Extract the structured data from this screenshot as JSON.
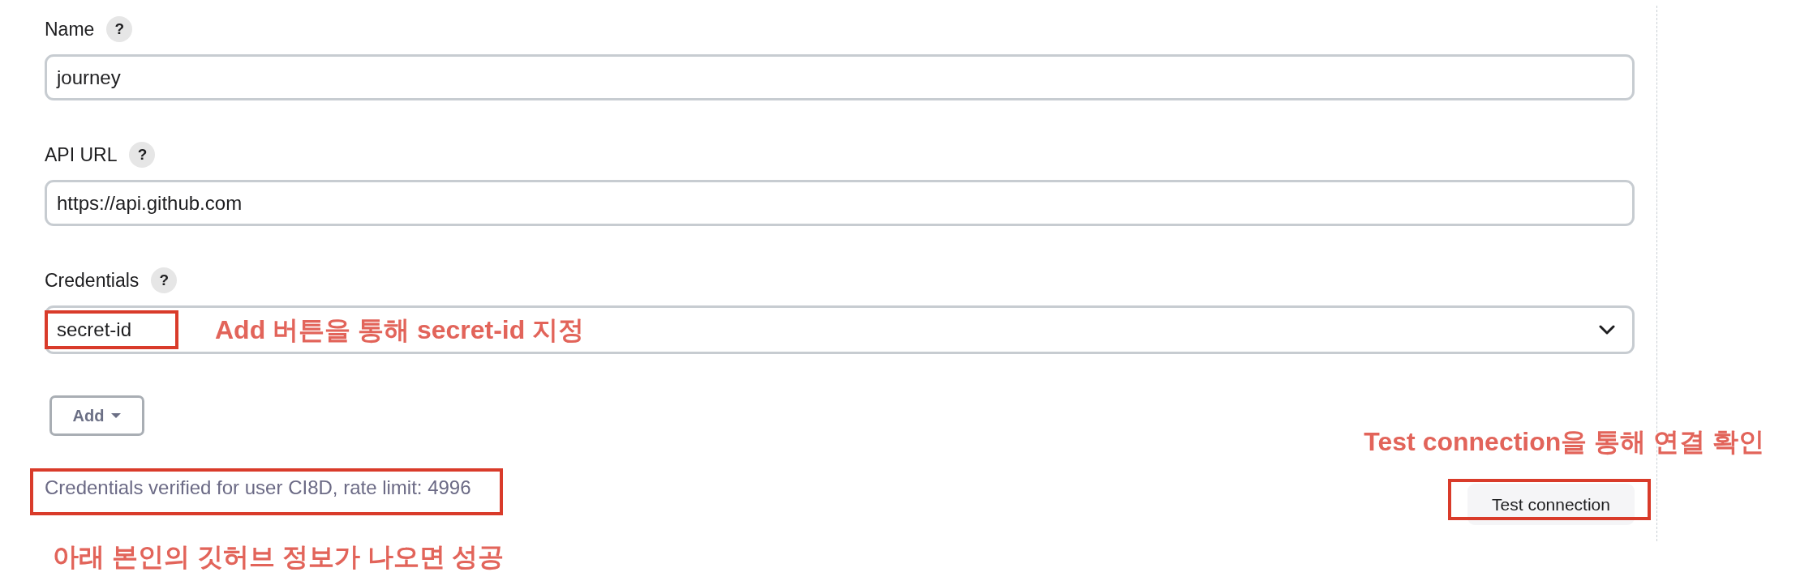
{
  "fields": [
    {
      "kind": "text",
      "label": "Name",
      "help": "?",
      "value": "journey",
      "highlighted": false
    },
    {
      "kind": "text",
      "label": "API URL",
      "help": "?",
      "value": "https://api.github.com",
      "highlighted": false
    },
    {
      "kind": "select",
      "label": "Credentials",
      "help": "?",
      "value": "secret-id",
      "highlighted": true,
      "annotation": "Add 버튼을 통해 secret-id 지정"
    }
  ],
  "add_button": {
    "label": "Add"
  },
  "status": {
    "text": "Credentials verified for user CI8D, rate limit: 4996",
    "highlighted": true,
    "annotation": "아래 본인의 깃허브 정보가 나오면 성공"
  },
  "test_button": {
    "label": "Test connection",
    "highlighted": true,
    "annotation": "Test connection을 통해 연결 확인"
  }
}
